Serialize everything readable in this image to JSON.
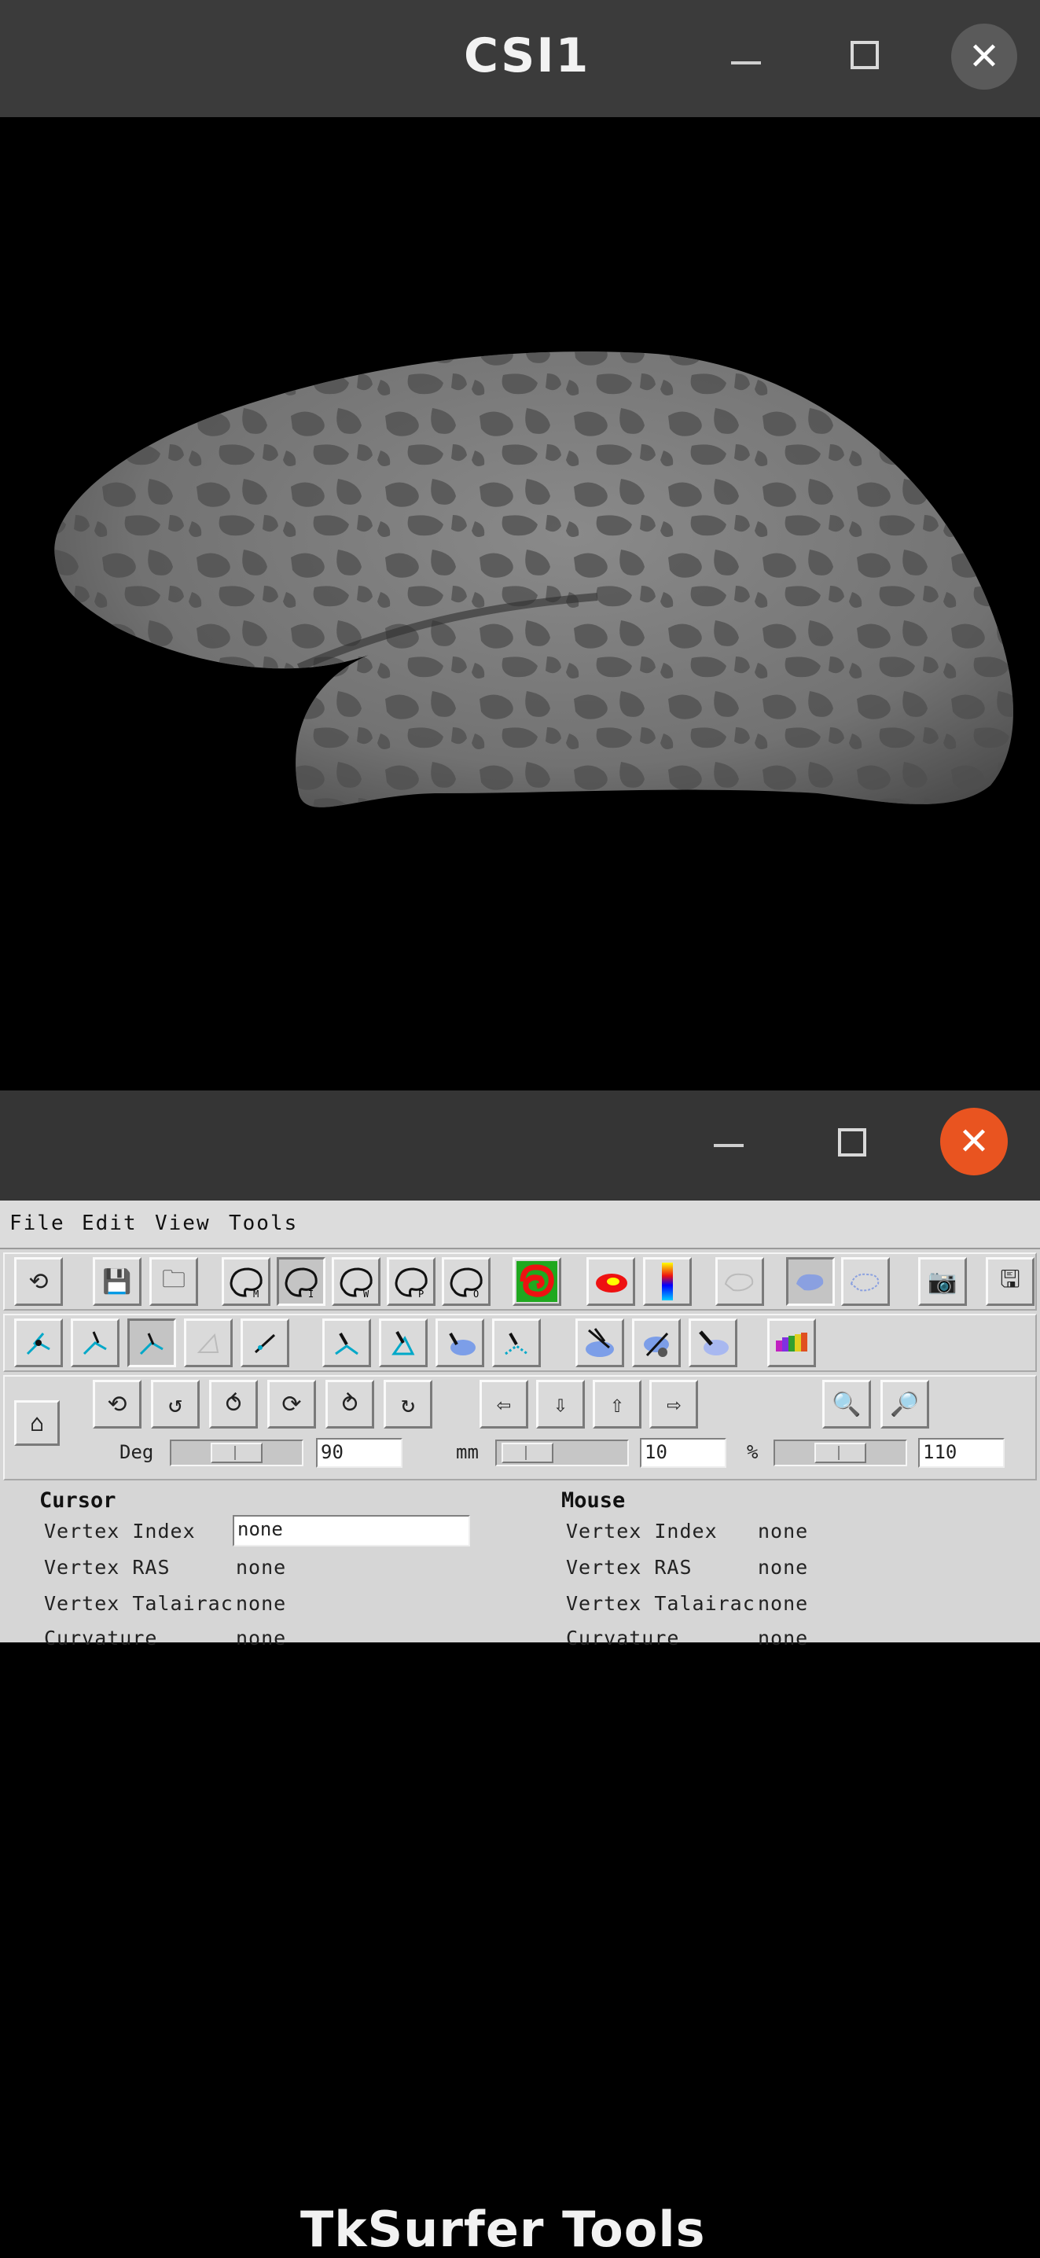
{
  "viewer_window": {
    "title": "CSI1",
    "controls": {
      "minimize": "minimize-icon",
      "maximize": "maximize-icon",
      "close": "close-icon"
    }
  },
  "tools_window": {
    "title": "TkSurfer Tools",
    "controls": {
      "minimize": "minimize-icon",
      "maximize": "maximize-icon",
      "close": "close-icon"
    },
    "close_color": "#e95420"
  },
  "menu": [
    "File",
    "Edit",
    "View",
    "Tools"
  ],
  "toolbar1": [
    {
      "name": "redraw-icon",
      "letter": ""
    },
    {
      "name": "save-icon",
      "letter": ""
    },
    {
      "name": "open-folder-icon",
      "letter": ""
    },
    {
      "name": "main-surface-icon",
      "letter": "M"
    },
    {
      "name": "inflated-surface-icon",
      "letter": "I"
    },
    {
      "name": "white-surface-icon",
      "letter": "W"
    },
    {
      "name": "pial-surface-icon",
      "letter": "P"
    },
    {
      "name": "original-surface-icon",
      "letter": "O"
    },
    {
      "name": "label-overlay-icon",
      "letter": ""
    },
    {
      "name": "overlay-blob-icon",
      "letter": ""
    },
    {
      "name": "color-scale-icon",
      "letter": ""
    },
    {
      "name": "curvature-off-icon",
      "letter": ""
    },
    {
      "name": "curvature-binary-icon",
      "letter": ""
    },
    {
      "name": "curvature-outline-icon",
      "letter": ""
    },
    {
      "name": "snapshot-icon",
      "letter": ""
    },
    {
      "name": "save-frame-icon",
      "letter": ""
    }
  ],
  "toolbar2": [
    "navigate-tool-icon",
    "select-vertex-icon",
    "path-tool-icon",
    "plane-tool-icon",
    "line-tool-icon",
    "mark-path-icon",
    "close-path-icon",
    "fill-label-icon",
    "custom-fill-icon",
    "cut-surface-icon",
    "cut-plane-icon",
    "smooth-icon",
    "colorbar-icon"
  ],
  "transform": {
    "home_icon": "home-icon",
    "rotate_icons": [
      "rotate-x-left-icon",
      "rotate-y-left-icon",
      "rotate-z-left-icon",
      "rotate-x-right-icon",
      "rotate-y-right-icon",
      "rotate-z-right-icon"
    ],
    "arrow_icons": [
      "arrow-left-icon",
      "arrow-down-icon",
      "arrow-up-icon",
      "arrow-right-icon"
    ],
    "zoom_icons": [
      "zoom-out-icon",
      "zoom-in-icon"
    ],
    "deg_label": "Deg",
    "deg_value": "90",
    "mm_label": "mm",
    "mm_value": "10",
    "pct_label": "%",
    "pct_value": "110"
  },
  "cursor": {
    "heading": "Cursor",
    "rows": [
      {
        "label": "Vertex Index",
        "value": "none"
      },
      {
        "label": "Vertex RAS",
        "value": "none"
      },
      {
        "label": "Vertex Talairac",
        "value": "none"
      },
      {
        "label": "Curvature",
        "value": "none"
      }
    ]
  },
  "mouse": {
    "heading": "Mouse",
    "rows": [
      {
        "label": "Vertex Index",
        "value": "none"
      },
      {
        "label": "Vertex RAS",
        "value": "none"
      },
      {
        "label": "Vertex Talairac",
        "value": "none"
      },
      {
        "label": "Curvature",
        "value": "none"
      }
    ]
  }
}
